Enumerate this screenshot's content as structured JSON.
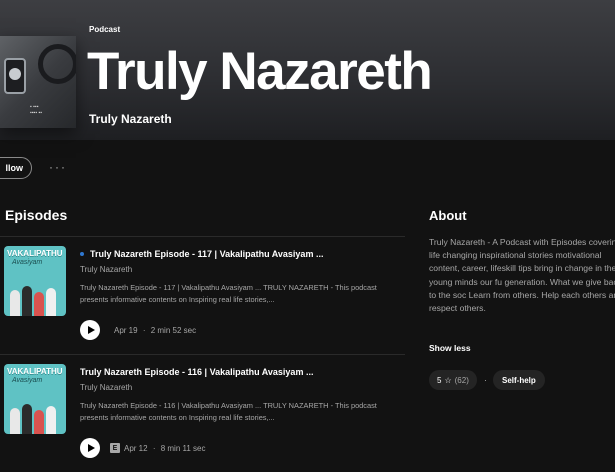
{
  "header": {
    "type_label": "Podcast",
    "title": "Truly Nazareth",
    "author": "Truly Nazareth",
    "cover_icon": "podcast-cover-art"
  },
  "actions": {
    "follow_label": "llow",
    "more_label": "···"
  },
  "episodes": {
    "heading": "Episodes",
    "items": [
      {
        "title": "Truly Nazareth Episode - 117 | Vakalipathu Avasiyam ...",
        "show": "Truly Nazareth",
        "description": "Truly Nazareth Episode - 117 | Vakalipathu Avasiyam ... TRULY NAZARETH - This podcast presents informative contents on Inspiring real life stories,...",
        "date": "Apr 19",
        "duration": "2 min 52 sec",
        "new": true,
        "explicit": false,
        "thumb_title": "VAKALIPATHU",
        "thumb_sub": "Avasiyam"
      },
      {
        "title": "Truly Nazareth Episode - 116 | Vakalipathu Avasiyam ...",
        "show": "Truly Nazareth",
        "description": "Truly Nazareth Episode - 116 | Vakalipathu Avasiyam ... TRULY NAZARETH - This podcast presents informative contents on Inspiring real life stories,...",
        "date": "Apr 12",
        "duration": "8 min 11 sec",
        "new": false,
        "explicit": true,
        "explicit_label": "E",
        "thumb_title": "VAKALIPATHU",
        "thumb_sub": "Avasiyam"
      }
    ],
    "meta_separator": "·"
  },
  "about": {
    "heading": "About",
    "text": "Truly Nazareth - A Podcast with Episodes covering life changing inspirational stories motivational content, career, lifeskill tips bring in change in the young minds our fu generation. What we give back to the soc Learn from others. Help each others and respect others.",
    "show_less": "Show less",
    "rating_value": "5",
    "rating_star": "☆",
    "rating_count": "(62)",
    "separator": "·",
    "category": "Self-help"
  },
  "colors": {
    "background": "#121212",
    "header_gradient_top": "#3d3e42",
    "text_primary": "#ffffff",
    "text_secondary": "#a7a7a7",
    "new_dot": "#2e77d0",
    "thumb_bg": "#5fc2c4"
  }
}
